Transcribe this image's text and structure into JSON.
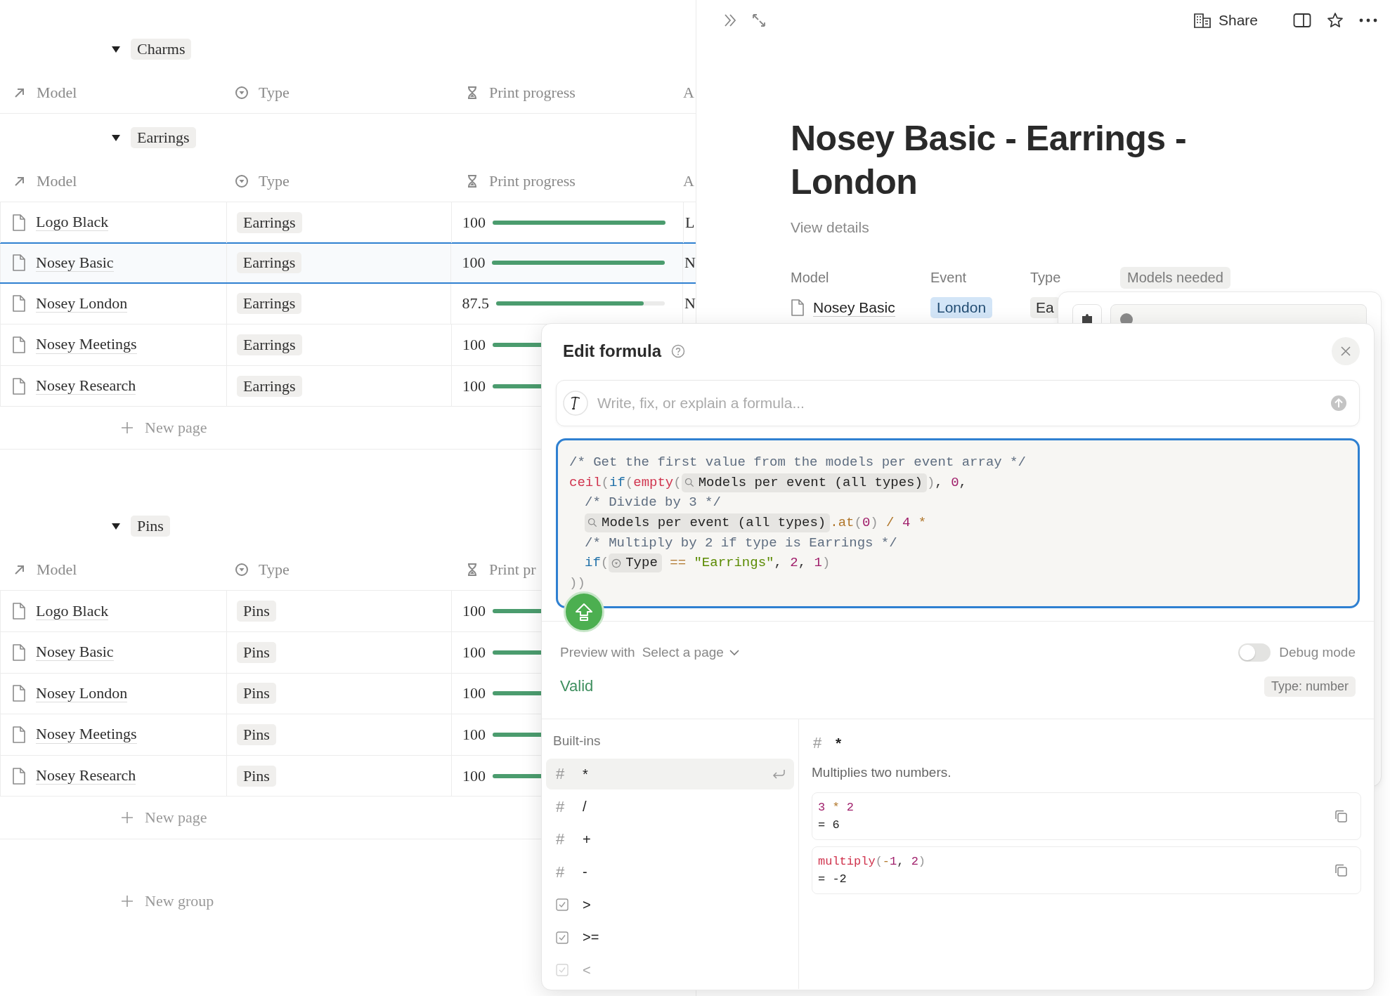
{
  "table": {
    "groups": [
      {
        "name": "Charms",
        "expanded": true,
        "columns": [
          {
            "label": "Model"
          },
          {
            "label": "Type"
          },
          {
            "label": "Print progress"
          },
          {
            "label": "A"
          }
        ]
      },
      {
        "name": "Earrings",
        "expanded": true,
        "columns": [
          {
            "label": "Model"
          },
          {
            "label": "Type"
          },
          {
            "label": "Print progress"
          },
          {
            "label": "A"
          }
        ],
        "rows": [
          {
            "model": "Logo Black",
            "type": "Earrings",
            "progress": "100",
            "level": 1,
            "column_4": "L",
            "selected": false
          },
          {
            "model": "Nosey Basic",
            "type": "Earrings",
            "progress": "100",
            "level": 1,
            "column_4": "N",
            "selected": true
          },
          {
            "model": "Nosey London",
            "type": "Earrings",
            "progress": "87.5",
            "level": 0.875,
            "column_4": "N",
            "selected": false
          },
          {
            "model": "Nosey Meetings",
            "type": "Earrings",
            "progress": "100",
            "level": 1,
            "selected": false
          },
          {
            "model": "Nosey Research",
            "type": "Earrings",
            "progress": "100",
            "level": 1,
            "selected": false
          }
        ],
        "new_page": "New page"
      },
      {
        "name": "Pins",
        "expanded": true,
        "columns": [
          {
            "label": "Model"
          },
          {
            "label": "Type"
          },
          {
            "label": "Print pr"
          }
        ],
        "rows": [
          {
            "model": "Logo Black",
            "type": "Pins",
            "progress": "100",
            "level": 1,
            "selected": false
          },
          {
            "model": "Nosey Basic",
            "type": "Pins",
            "progress": "100",
            "level": 1,
            "selected": false
          },
          {
            "model": "Nosey London",
            "type": "Pins",
            "progress": "100",
            "level": 1,
            "selected": false
          },
          {
            "model": "Nosey Meetings",
            "type": "Pins",
            "progress": "100",
            "level": 1,
            "selected": false
          },
          {
            "model": "Nosey Research",
            "type": "Pins",
            "progress": "100",
            "level": 1,
            "selected": false
          }
        ],
        "new_page": "New page"
      }
    ],
    "new_group": "New group"
  },
  "topbar": {
    "share": "Share"
  },
  "page": {
    "title": "Nosey Basic - Earrings - London",
    "details_link": "View details",
    "properties": [
      {
        "label": "Model",
        "value": "Nosey Basic",
        "kind": "page",
        "selected": false
      },
      {
        "label": "Event",
        "value": "London",
        "kind": "tag",
        "selected": false
      },
      {
        "label": "Type",
        "value": "Ea",
        "kind": "chip",
        "selected": false
      },
      {
        "label": "Models needed",
        "selected": true
      }
    ]
  },
  "formula_dialog": {
    "title": "Edit formula",
    "ai_placeholder": "Write, fix, or explain a formula...",
    "code": [
      {
        "indented": false,
        "tokens": [
          {
            "kind": "comment",
            "text": "/* Get the first value from the models per event array */"
          }
        ]
      },
      {
        "indented": false,
        "tokens": [
          {
            "kind": "func",
            "text": "ceil"
          },
          {
            "kind": "paren",
            "text": "("
          },
          {
            "kind": "keyword",
            "text": "if"
          },
          {
            "kind": "paren",
            "text": "("
          },
          {
            "kind": "func",
            "text": "empty"
          },
          {
            "kind": "paren",
            "text": "("
          },
          {
            "kind": "rollup",
            "text": "Models per event (all types)"
          },
          {
            "kind": "paren",
            "text": ")"
          },
          {
            "kind": "text",
            "text": ", "
          },
          {
            "kind": "num",
            "text": "0"
          },
          {
            "kind": "text",
            "text": ","
          }
        ]
      },
      {
        "indented": true,
        "tokens": [
          {
            "kind": "comment",
            "text": "/* Divide by 3 */"
          }
        ]
      },
      {
        "indented": true,
        "tokens": [
          {
            "kind": "rollup",
            "text": "Models per event (all types)"
          },
          {
            "kind": "method",
            "text": ".at"
          },
          {
            "kind": "paren",
            "text": "("
          },
          {
            "kind": "num",
            "text": "0"
          },
          {
            "kind": "paren",
            "text": ")"
          },
          {
            "kind": "op",
            "text": " / "
          },
          {
            "kind": "num",
            "text": "4"
          },
          {
            "kind": "op",
            "text": " *"
          }
        ]
      },
      {
        "indented": true,
        "tokens": [
          {
            "kind": "comment",
            "text": "/* Multiply by 2 if type is Earrings */"
          }
        ]
      },
      {
        "indented": true,
        "tokens": [
          {
            "kind": "keyword",
            "text": "if"
          },
          {
            "kind": "paren",
            "text": "("
          },
          {
            "kind": "select",
            "text": "Type"
          },
          {
            "kind": "op",
            "text": " == "
          },
          {
            "kind": "str",
            "text": "\"Earrings\""
          },
          {
            "kind": "text",
            "text": ", "
          },
          {
            "kind": "num",
            "text": "2"
          },
          {
            "kind": "text",
            "text": ", "
          },
          {
            "kind": "num",
            "text": "1"
          },
          {
            "kind": "paren",
            "text": ")"
          }
        ]
      },
      {
        "indented": false,
        "tokens": [
          {
            "kind": "paren",
            "text": "))"
          }
        ]
      }
    ],
    "preview_label": "Preview with",
    "preview_select": "Select a page",
    "debug": {
      "label": "Debug mode",
      "on": false
    },
    "status": "Valid",
    "result_type": "Type: number",
    "builtins_title": "Built-ins",
    "builtins": [
      {
        "kind": "number",
        "glyph": "#",
        "label": "*",
        "selected": true,
        "disabled": false
      },
      {
        "kind": "number",
        "glyph": "#",
        "label": "/",
        "selected": false,
        "disabled": false
      },
      {
        "kind": "number",
        "glyph": "#",
        "label": "+",
        "selected": false,
        "disabled": false
      },
      {
        "kind": "number",
        "glyph": "#",
        "label": "-",
        "selected": false,
        "disabled": false
      },
      {
        "kind": "boolean",
        "label": ">",
        "selected": false,
        "disabled": false
      },
      {
        "kind": "boolean",
        "label": ">=",
        "selected": false,
        "disabled": false
      },
      {
        "kind": "boolean",
        "label": "<",
        "selected": false,
        "disabled": true
      }
    ],
    "detail": {
      "glyph": "#",
      "name": "*",
      "description": "Multiplies two numbers.",
      "examples": [
        {
          "tokens": [
            {
              "kind": "num",
              "text": "3"
            },
            {
              "kind": "op",
              "text": " * "
            },
            {
              "kind": "num",
              "text": "2"
            }
          ],
          "result": "= 6"
        },
        {
          "tokens": [
            {
              "kind": "func",
              "text": "multiply"
            },
            {
              "kind": "paren",
              "text": "("
            },
            {
              "kind": "op",
              "text": "-"
            },
            {
              "kind": "num",
              "text": "1"
            },
            {
              "kind": "text",
              "text": ", "
            },
            {
              "kind": "num",
              "text": "2"
            },
            {
              "kind": "paren",
              "text": ")"
            }
          ],
          "result": "= -2"
        }
      ]
    }
  }
}
